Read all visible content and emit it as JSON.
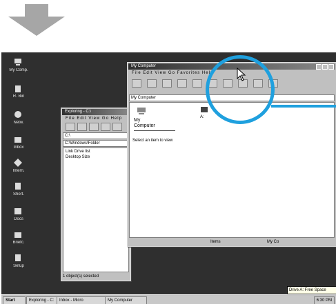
{
  "desktop": {
    "icons": [
      {
        "icon": "my-computer-icon",
        "label": "My Comp."
      },
      {
        "icon": "recycle-bin-icon",
        "label": "R. Bin"
      },
      {
        "icon": "network-icon",
        "label": "Netw."
      },
      {
        "icon": "folder-icon",
        "label": "Inbox"
      },
      {
        "icon": "internet-icon",
        "label": "Intern."
      },
      {
        "icon": "shortcut-icon",
        "label": "Short."
      },
      {
        "icon": "folder-icon",
        "label": "Docs"
      },
      {
        "icon": "briefcase-icon",
        "label": "Briefc."
      },
      {
        "icon": "program-icon",
        "label": "Setup"
      }
    ]
  },
  "back_window": {
    "title": "Exploring - C:\\",
    "menu": "File Edit View Go Help",
    "address": "C:\\",
    "address_line2": "C:\\Windows\\Folder",
    "list": [
      "Link  Drive list",
      "Desktop Size"
    ],
    "status": "1 object(s) selected"
  },
  "front_window": {
    "title": "My Computer",
    "menu": "File Edit View Go Favorites Help",
    "address": "My Computer",
    "left_pane_title": "My",
    "left_pane_title2": "Computer",
    "left_pane_desc": "Select an item to view",
    "icon_label": "A:",
    "status_left": "Items",
    "status_right": "My Co"
  },
  "taskbar": {
    "start": "Start",
    "buttons": [
      "Exploring - C:",
      "Inbox - Micro",
      "My Computer"
    ],
    "tray": "6:30 PM",
    "tooltip": "Drive A: Free Space"
  },
  "colors": {
    "highlight": "#1fa0de",
    "arrow": "#a6a6a6",
    "desktop": "#2f2f2f"
  }
}
